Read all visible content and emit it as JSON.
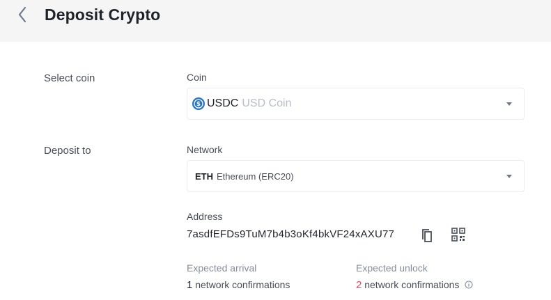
{
  "header": {
    "title": "Deposit Crypto"
  },
  "sections": {
    "select_coin": "Select coin",
    "deposit_to": "Deposit to"
  },
  "coin": {
    "label": "Coin",
    "symbol": "USDC",
    "name": "USD Coin",
    "icon": "usdc-coin-icon",
    "icon_color": "#2775ca"
  },
  "network": {
    "label": "Network",
    "symbol": "ETH",
    "name": "Ethereum (ERC20)"
  },
  "address": {
    "label": "Address",
    "value": "7asdfEFDs9TuM7b4b3oKf4bkVF24xAXU77"
  },
  "arrival": {
    "label": "Expected arrival",
    "count": "1",
    "suffix": "network confirmations"
  },
  "unlock": {
    "label": "Expected unlock",
    "count": "2",
    "suffix": "network confirmations"
  },
  "colors": {
    "accent_red": "#f6465d",
    "header_bg": "#f5f5f5"
  }
}
